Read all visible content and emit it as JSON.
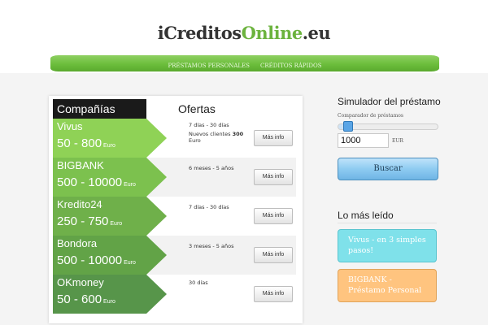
{
  "brand": {
    "part1": "iCreditos",
    "part2": "Online",
    "part3": ".eu"
  },
  "nav": {
    "items": [
      "PRÉSTAMOS PERSONALES",
      "CRÉDITOS RÁPIDOS"
    ]
  },
  "table": {
    "header_company": "Compañías",
    "header_offers": "Ofertas",
    "rows": [
      {
        "name": "Vivus",
        "amount": "50 - 800",
        "unit": "Euro",
        "term": "7 días - 30 días",
        "extra_prefix": "Nuevos clientes ",
        "extra_bold": "300",
        "extra_suffix": " Euro",
        "button": "Más info",
        "color": "#8fd256"
      },
      {
        "name": "BIGBANK",
        "amount": "500 - 10000",
        "unit": "Euro",
        "term": "6 meses - 5 años",
        "extra_prefix": "",
        "extra_bold": "",
        "extra_suffix": "",
        "button": "Más info",
        "color": "#7cc14e"
      },
      {
        "name": "Kredito24",
        "amount": "250 - 750",
        "unit": "Euro",
        "term": "7 días - 30 días",
        "extra_prefix": "",
        "extra_bold": "",
        "extra_suffix": "",
        "button": "Más info",
        "color": "#6fb04a"
      },
      {
        "name": "Bondora",
        "amount": "500 - 10000",
        "unit": "Euro",
        "term": "3 meses - 5 años",
        "extra_prefix": "",
        "extra_bold": "",
        "extra_suffix": "",
        "button": "Más info",
        "color": "#62a347"
      },
      {
        "name": "OKmoney",
        "amount": "50 - 600",
        "unit": "Euro",
        "term": "30 días",
        "extra_prefix": "",
        "extra_bold": "",
        "extra_suffix": "",
        "button": "Más info",
        "color": "#57954a"
      }
    ]
  },
  "simulator": {
    "title": "Simulador del préstamo",
    "label": "Comparador de préstamos",
    "amount_value": "1000",
    "currency": "EUR",
    "button": "Buscar"
  },
  "popular": {
    "title": "Lo más leído",
    "items": [
      "Vivus - en 3 simples pasos!",
      "BIGBANK - Préstamo Personal"
    ]
  },
  "colors": {
    "accent_green": "#6cb33e",
    "button_blue": "#8ecbf1",
    "card_cyan": "#7fe1ea",
    "card_orange": "#ffc47f"
  }
}
